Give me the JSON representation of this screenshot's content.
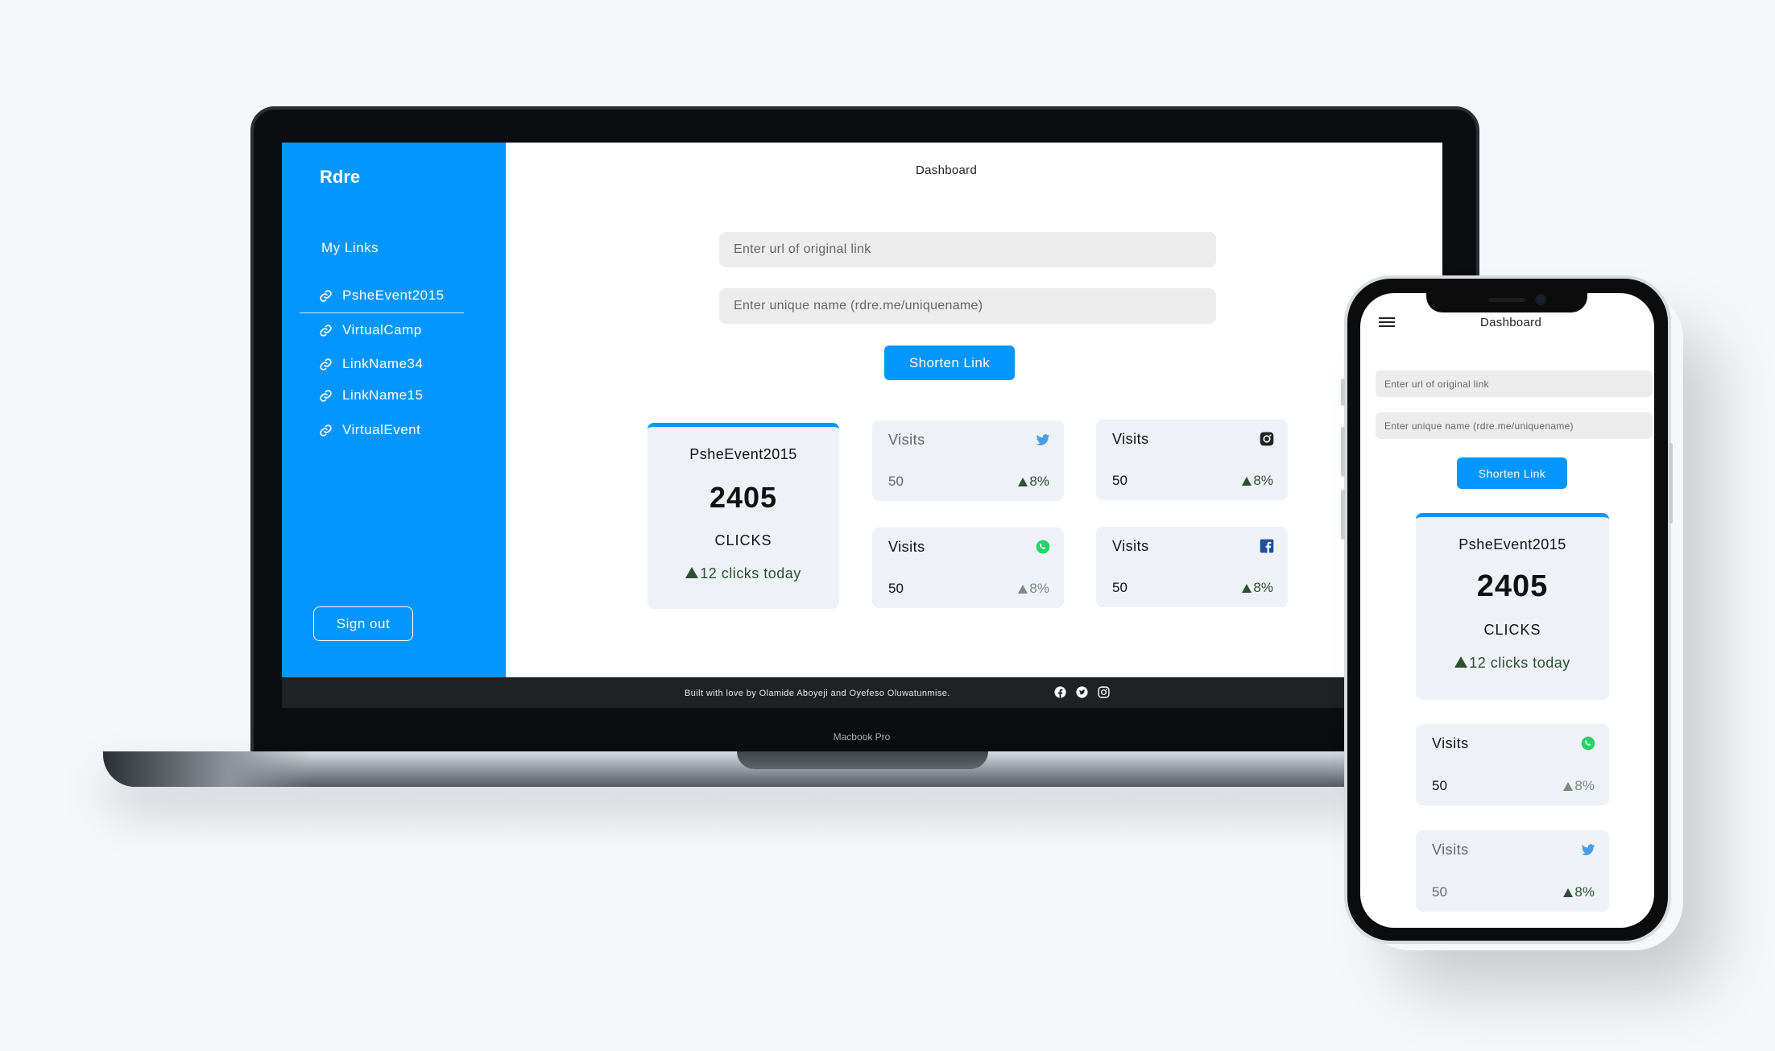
{
  "laptop": {
    "brand": "Rdre",
    "page_title": "Dashboard",
    "sidebar": {
      "section_title": "My Links",
      "links": [
        "PsheEvent2015",
        "VirtualCamp",
        "LinkName34",
        "LinkName15",
        "VirtualEvent"
      ],
      "sign_out": "Sign out"
    },
    "form": {
      "url_placeholder": "Enter url of original link",
      "name_placeholder": "Enter unique name (rdre.me/uniquename)",
      "button": "Shorten Link"
    },
    "main_card": {
      "name": "PsheEvent2015",
      "clicks": "2405",
      "label": "CLICKS",
      "today": "12 clicks today"
    },
    "visit_cards": [
      {
        "label": "Visits",
        "value": "50",
        "pct": "8%",
        "icon": "twitter-icon"
      },
      {
        "label": "Visits",
        "value": "50",
        "pct": "8%",
        "icon": "instagram-icon"
      },
      {
        "label": "Visits",
        "value": "50",
        "pct": "8%",
        "icon": "whatsapp-icon"
      },
      {
        "label": "Visits",
        "value": "50",
        "pct": "8%",
        "icon": "facebook-icon"
      }
    ],
    "footer": {
      "text": "Built with love by Olamide Aboyeji and Oyefeso Oluwatunmise."
    },
    "device_label": "Macbook Pro"
  },
  "phone": {
    "page_title": "Dashboard",
    "form": {
      "url_placeholder": "Enter url of original link",
      "name_placeholder": "Enter unique name (rdre.me/uniquename)",
      "button": "Shorten Link"
    },
    "main_card": {
      "name": "PsheEvent2015",
      "clicks": "2405",
      "label": "CLICKS",
      "today": "12 clicks today"
    },
    "visit_cards": [
      {
        "label": "Visits",
        "value": "50",
        "pct": "8%",
        "icon": "whatsapp-icon"
      },
      {
        "label": "Visits",
        "value": "50",
        "pct": "8%",
        "icon": "twitter-icon"
      }
    ]
  },
  "colors": {
    "accent": "#0396ff",
    "card_bg": "#eef1f8",
    "positive": "#2f4f2f",
    "footer_bg": "#1f2124"
  }
}
